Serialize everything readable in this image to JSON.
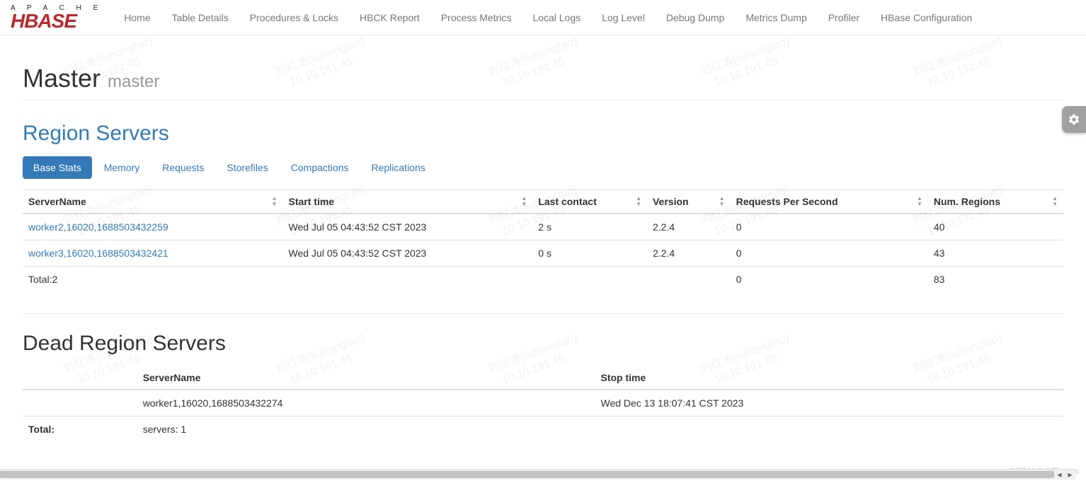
{
  "brand": {
    "line1": "A P A C H E",
    "line2": "HBASE"
  },
  "nav": [
    "Home",
    "Table Details",
    "Procedures & Locks",
    "HBCK Report",
    "Process Metrics",
    "Local Logs",
    "Log Level",
    "Debug Dump",
    "Metrics Dump",
    "Profiler",
    "HBase Configuration"
  ],
  "title": {
    "main": "Master",
    "sub": "master"
  },
  "region_servers": {
    "heading": "Region Servers",
    "tabs": [
      "Base Stats",
      "Memory",
      "Requests",
      "Storefiles",
      "Compactions",
      "Replications"
    ],
    "active_tab": 0,
    "columns": [
      "ServerName",
      "Start time",
      "Last contact",
      "Version",
      "Requests Per Second",
      "Num. Regions"
    ],
    "rows": [
      {
        "server": "worker2,16020,1688503432259",
        "start": "Wed Jul 05 04:43:52 CST 2023",
        "last": "2 s",
        "version": "2.2.4",
        "rps": "0",
        "regions": "40"
      },
      {
        "server": "worker3,16020,1688503432421",
        "start": "Wed Jul 05 04:43:52 CST 2023",
        "last": "0 s",
        "version": "2.2.4",
        "rps": "0",
        "regions": "43"
      }
    ],
    "total": {
      "label": "Total:2",
      "rps": "0",
      "regions": "83"
    }
  },
  "dead_servers": {
    "heading": "Dead Region Servers",
    "columns": [
      "ServerName",
      "Stop time"
    ],
    "rows": [
      {
        "server": "worker1,16020,1688503432274",
        "stop": "Wed Dec 13 18:07:41 CST 2023"
      }
    ],
    "total": {
      "label": "Total:",
      "value": "servers: 1"
    }
  },
  "watermark": {
    "name": "刘红涛(liuhongtao)",
    "ip": "10.10.191.45"
  },
  "footer": "CSDN @IMZwens"
}
